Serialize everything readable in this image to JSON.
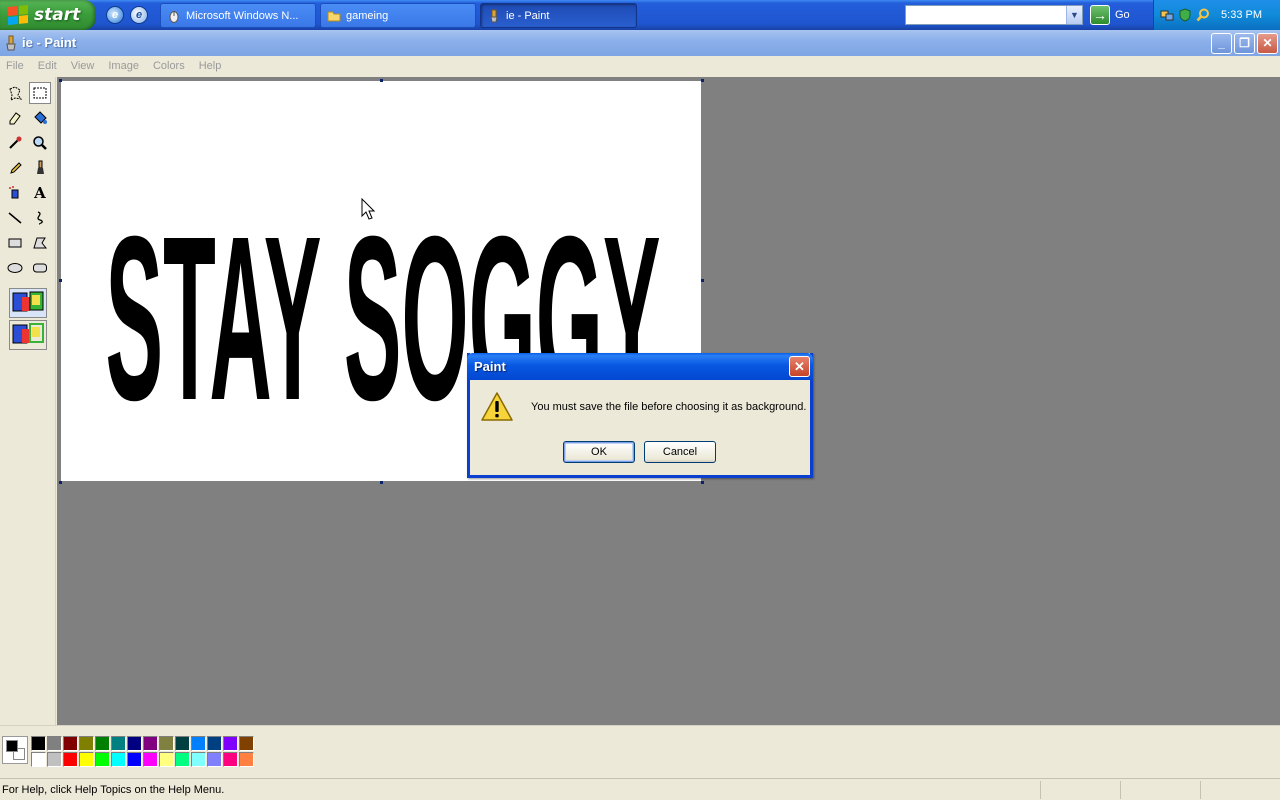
{
  "taskbar": {
    "start_label": "start",
    "tasks": [
      {
        "label": "Microsoft Windows N...",
        "icon": "mouse-icon"
      },
      {
        "label": "gameing",
        "icon": "folder-icon"
      },
      {
        "label": "ie - Paint",
        "icon": "paint-icon"
      }
    ],
    "search": {
      "value": ""
    },
    "go_label": "Go",
    "clock": "5:33 PM"
  },
  "window": {
    "title": "ie - Paint",
    "minimize": "_",
    "maximize": "❐",
    "close": "✕"
  },
  "menu": {
    "items": [
      "File",
      "Edit",
      "View",
      "Image",
      "Colors",
      "Help"
    ]
  },
  "canvas": {
    "text": "STAY SOGGY",
    "background_color": "#ffffff",
    "text_color": "#000000"
  },
  "palette": {
    "foreground": "#000000",
    "background": "#ffffff",
    "row1": [
      "#000000",
      "#808080",
      "#800000",
      "#808000",
      "#008000",
      "#008080",
      "#000080",
      "#800080",
      "#808040",
      "#004040",
      "#0080ff",
      "#004080",
      "#8000ff",
      "#804000"
    ],
    "row2": [
      "#ffffff",
      "#c0c0c0",
      "#ff0000",
      "#ffff00",
      "#00ff00",
      "#00ffff",
      "#0000ff",
      "#ff00ff",
      "#ffff80",
      "#00ff80",
      "#80ffff",
      "#8080ff",
      "#ff0080",
      "#ff8040"
    ]
  },
  "status": {
    "help_text": "For Help, click Help Topics on the Help Menu."
  },
  "dialog": {
    "title": "Paint",
    "message": "You must save the file before choosing it as background.",
    "ok_label": "OK",
    "cancel_label": "Cancel",
    "icon": "warning-icon"
  }
}
